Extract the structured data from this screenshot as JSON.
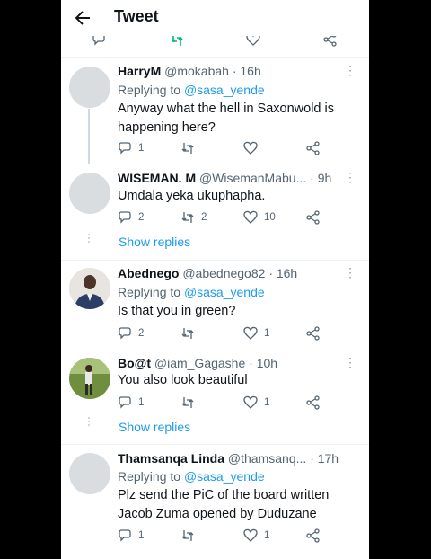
{
  "header": {
    "title": "Tweet"
  },
  "replies": [
    {
      "name": "HarryM",
      "handle": "@mokabah",
      "time": "· 16h",
      "replying_prefix": "Replying to ",
      "replying_to": "@sasa_yende",
      "text_lines": [
        "Anyway what the hell in Saxonwold is",
        "happening here?"
      ],
      "reply_count": "1",
      "retweet_count": "",
      "like_count": ""
    },
    {
      "name": "WISEMAN. M",
      "handle": "@WisemanMabu...",
      "time": "· 9h",
      "text_lines": [
        "Umdala yeka ukuphapha."
      ],
      "reply_count": "2",
      "retweet_count": "2",
      "like_count": "10",
      "show_replies": "Show replies"
    },
    {
      "name": "Abednego",
      "handle": "@abednego82",
      "time": "· 16h",
      "replying_prefix": "Replying to ",
      "replying_to": "@sasa_yende",
      "text_lines": [
        "Is that you in green?"
      ],
      "reply_count": "2",
      "retweet_count": "",
      "like_count": "1"
    },
    {
      "name": "Bo@t",
      "handle": "@iam_Gagashe",
      "time": "· 10h",
      "text_lines": [
        "You also look beautiful"
      ],
      "reply_count": "1",
      "retweet_count": "",
      "like_count": "1",
      "show_replies": "Show replies"
    },
    {
      "name": "Thamsanqa Linda",
      "handle": "@thamsanq...",
      "time": "· 17h",
      "replying_prefix": "Replying to ",
      "replying_to": "@sasa_yende",
      "text_lines": [
        "Plz send the PiC of the board written",
        "Jacob Zuma opened by Duduzane"
      ],
      "reply_count": "1",
      "retweet_count": "",
      "like_count": "1"
    }
  ],
  "colors": {
    "link": "#1d9bf0",
    "retweet_active": "#00ba7c",
    "muted": "#536471"
  }
}
